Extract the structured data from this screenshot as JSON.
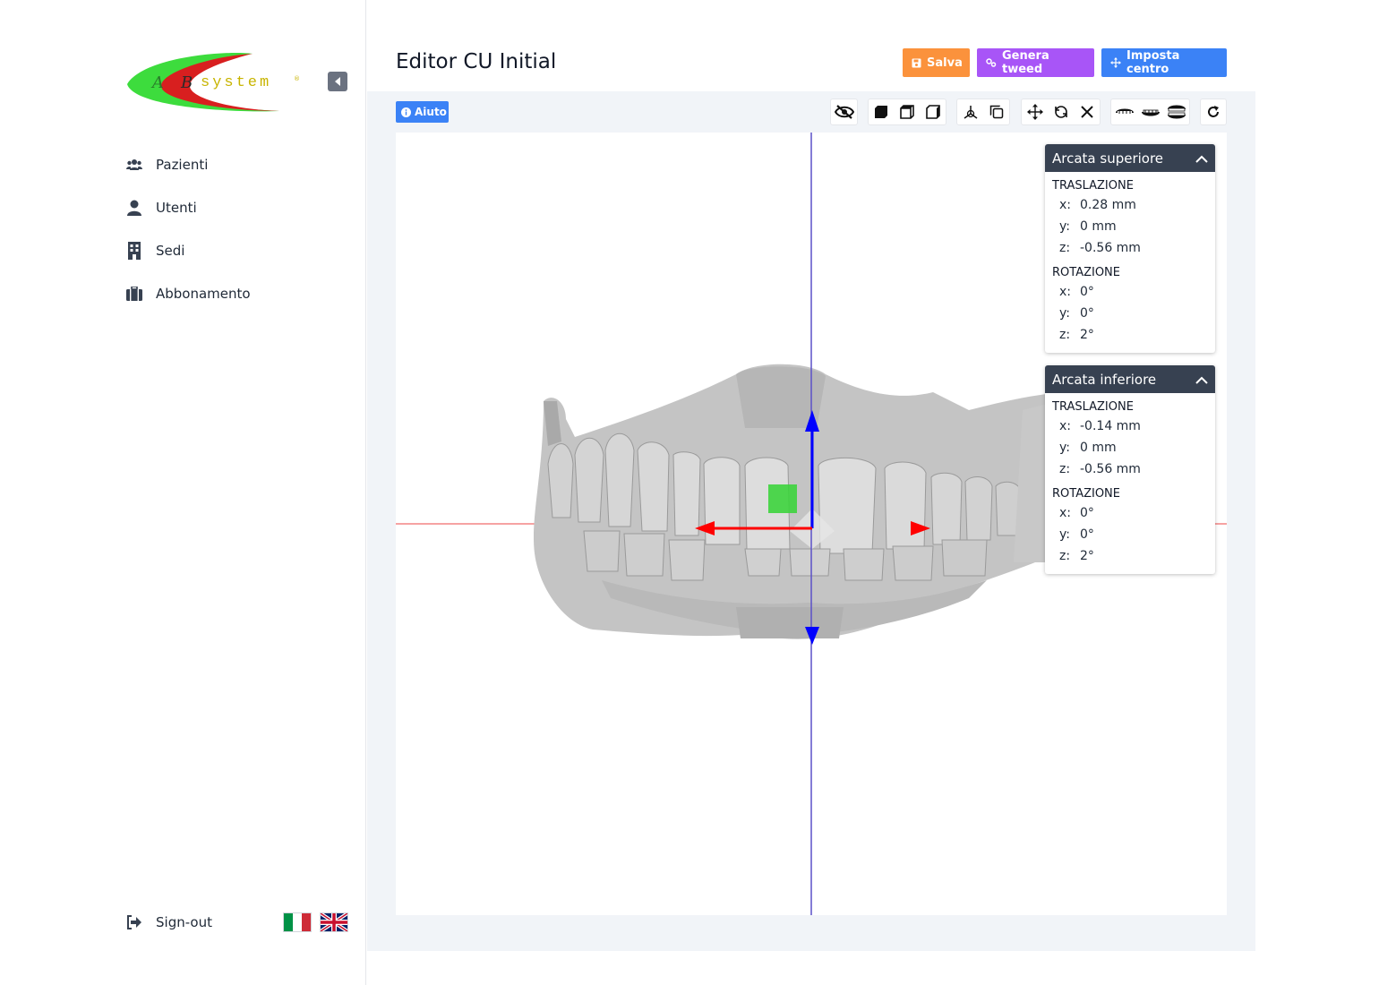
{
  "sidebar": {
    "logo_text": "ABsystem",
    "items": [
      {
        "label": "Pazienti",
        "icon": "users-icon"
      },
      {
        "label": "Utenti",
        "icon": "user-icon"
      },
      {
        "label": "Sedi",
        "icon": "building-icon"
      },
      {
        "label": "Abbonamento",
        "icon": "briefcase-icon"
      }
    ],
    "signout_label": "Sign-out",
    "languages": [
      "it",
      "en"
    ]
  },
  "header": {
    "title": "Editor CU Initial",
    "actions": {
      "save_label": "Salva",
      "tweed_label": "Genera tweed",
      "center_label": "Imposta centro"
    },
    "colors": {
      "save": "#fb923c",
      "tweed": "#a855f7",
      "center": "#3b82f6"
    }
  },
  "toolbar": {
    "help_label": "Aiuto",
    "tools": [
      "eye-slash-icon",
      "cube-solid-icon",
      "cube-front-icon",
      "cube-side-icon",
      "axis-icon",
      "copy-icon",
      "move-icon",
      "rotate-icon",
      "close-icon",
      "upper-arch-icon",
      "lower-arch-icon",
      "both-arches-icon",
      "refresh-icon"
    ]
  },
  "panels": {
    "upper": {
      "title": "Arcata superiore",
      "translation_title": "TRASLAZIONE",
      "translation": {
        "x": "0.28 mm",
        "y": "0 mm",
        "z": "-0.56 mm"
      },
      "rotation_title": "ROTAZIONE",
      "rotation": {
        "x": "0°",
        "y": "0°",
        "z": "2°"
      }
    },
    "lower": {
      "title": "Arcata inferiore",
      "translation_title": "TRASLAZIONE",
      "translation": {
        "x": "-0.14 mm",
        "y": "0 mm",
        "z": "-0.56 mm"
      },
      "rotation_title": "ROTAZIONE",
      "rotation": {
        "x": "0°",
        "y": "0°",
        "z": "2°"
      }
    },
    "axis_labels": {
      "x": "x:",
      "y": "y:",
      "z": "z:"
    }
  },
  "scene": {
    "axis_colors": {
      "x": "#ff0000",
      "y": "#0000ff",
      "vertical_line": "#5b50c8",
      "handle": "#3dd43d"
    }
  }
}
